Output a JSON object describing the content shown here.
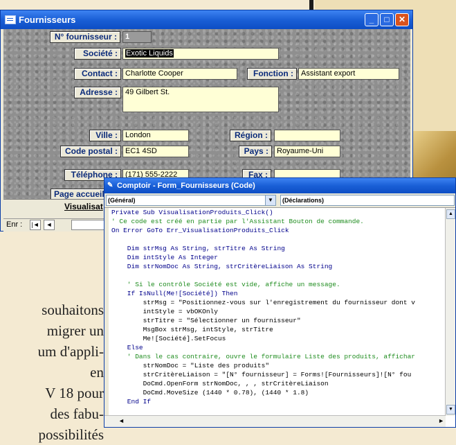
{
  "magazine": {
    "lines": [
      "souhaitons",
      "migrer   un",
      "um d'appli-",
      "en",
      "V 18   pour",
      "des  fabu-",
      "possibilités"
    ]
  },
  "fournisseurs_window": {
    "title": "Fournisseurs",
    "fields": {
      "n_fournisseur": {
        "label": "N° fournisseur :",
        "value": "1"
      },
      "societe": {
        "label": "Société :",
        "value": "Exotic Liquids"
      },
      "contact": {
        "label": "Contact :",
        "value": "Charlotte Cooper"
      },
      "fonction": {
        "label": "Fonction :",
        "value": "Assistant export"
      },
      "adresse": {
        "label": "Adresse :",
        "value": "49 Gilbert St."
      },
      "ville": {
        "label": "Ville :",
        "value": "London"
      },
      "region": {
        "label": "Région :",
        "value": ""
      },
      "code_postal": {
        "label": "Code postal :",
        "value": "EC1 4SD"
      },
      "pays": {
        "label": "Pays :",
        "value": "Royaume-Uni"
      },
      "telephone": {
        "label": "Téléphone :",
        "value": "(171) 555-2222"
      },
      "fax": {
        "label": "Fax :",
        "value": ""
      },
      "page_accueil": {
        "label": "Page accueil",
        "value": ""
      }
    },
    "visualisation_button": "Visualisat",
    "nav": {
      "record_label": "Enr :",
      "first": "|◄",
      "prev": "◄"
    }
  },
  "code_window": {
    "title": "Comptoir - Form_Fournisseurs (Code)",
    "object_combo": "(Général)",
    "proc_combo": "(Déclarations)",
    "code_lines": [
      {
        "t": "kw",
        "text": "Private Sub VisualisationProduits_Click()"
      },
      {
        "t": "cm",
        "text": "' Ce code est créé en partie par l'Assistant Bouton de commande."
      },
      {
        "t": "kw",
        "text": "On Error GoTo Err_VisualisationProduits_Click"
      },
      {
        "t": "",
        "text": ""
      },
      {
        "t": "kw",
        "text": "    Dim strMsg As String, strTitre As String"
      },
      {
        "t": "kw",
        "text": "    Dim intStyle As Integer"
      },
      {
        "t": "kw",
        "text": "    Dim strNomDoc As String, strCritèreLiaison As String"
      },
      {
        "t": "",
        "text": ""
      },
      {
        "t": "cm",
        "text": "    ' Si le contrôle Société est vide, affiche un message."
      },
      {
        "t": "kw",
        "text": "    If IsNull(Me![Société]) Then"
      },
      {
        "t": "",
        "text": "        strMsg = \"Positionnez-vous sur l'enregistrement du fournisseur dont v"
      },
      {
        "t": "",
        "text": "        intStyle = vbOKOnly"
      },
      {
        "t": "",
        "text": "        strTitre = \"Sélectionner un fournisseur\""
      },
      {
        "t": "",
        "text": "        MsgBox strMsg, intStyle, strTitre"
      },
      {
        "t": "",
        "text": "        Me![Société].SetFocus"
      },
      {
        "t": "kw",
        "text": "    Else"
      },
      {
        "t": "cm",
        "text": "    ' Dans le cas contraire, ouvre le formulaire Liste des produits, affichar"
      },
      {
        "t": "",
        "text": "        strNomDoc = \"Liste des produits\""
      },
      {
        "t": "",
        "text": "        strCritèreLiaison = \"[N° fournisseur] = Forms![Fournisseurs]![N° fou"
      },
      {
        "t": "",
        "text": "        DoCmd.OpenForm strNomDoc, , , strCritèreLiaison"
      },
      {
        "t": "",
        "text": "        DoCmd.MoveSize (1440 * 0.78), (1440 * 1.8)"
      },
      {
        "t": "kw",
        "text": "    End If"
      }
    ]
  }
}
